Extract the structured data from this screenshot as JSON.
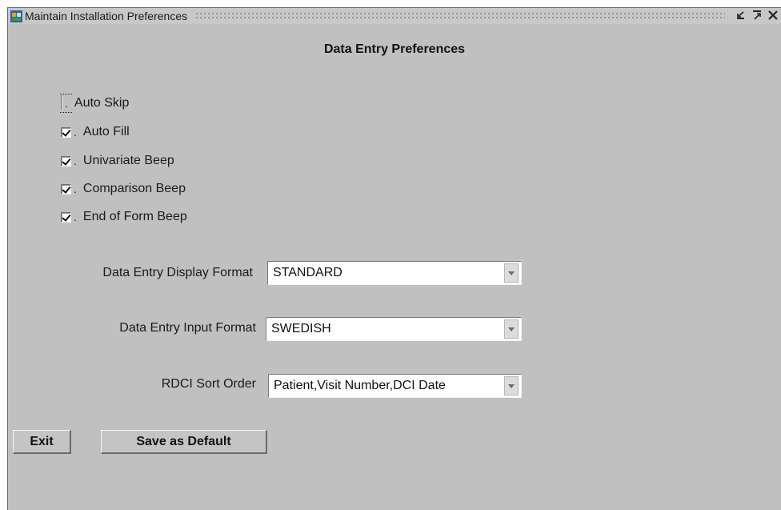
{
  "window": {
    "title": "Maintain Installation Preferences",
    "controls": {
      "minimize_icon": "minimize-icon",
      "maximize_icon": "maximize-icon",
      "close_icon": "close-icon"
    }
  },
  "heading": "Data Entry Preferences",
  "checkboxes": [
    {
      "label": "Auto Skip",
      "checked": false,
      "focused": true
    },
    {
      "label": "Auto Fill",
      "checked": true,
      "focused": false
    },
    {
      "label": "Univariate Beep",
      "checked": true,
      "focused": false
    },
    {
      "label": "Comparison Beep",
      "checked": true,
      "focused": false
    },
    {
      "label": "End of Form Beep",
      "checked": true,
      "focused": false
    }
  ],
  "fields": {
    "display_format": {
      "label": "Data Entry Display Format",
      "value": "STANDARD"
    },
    "input_format": {
      "label": "Data Entry Input Format",
      "value": "SWEDISH"
    },
    "sort_order": {
      "label": "RDCI  Sort Order",
      "value": "Patient,Visit Number,DCI Date"
    }
  },
  "buttons": {
    "exit": "Exit",
    "save_default": "Save as Default"
  },
  "colors": {
    "window_bg": "#c0c0c0",
    "field_bg": "#ffffff"
  }
}
